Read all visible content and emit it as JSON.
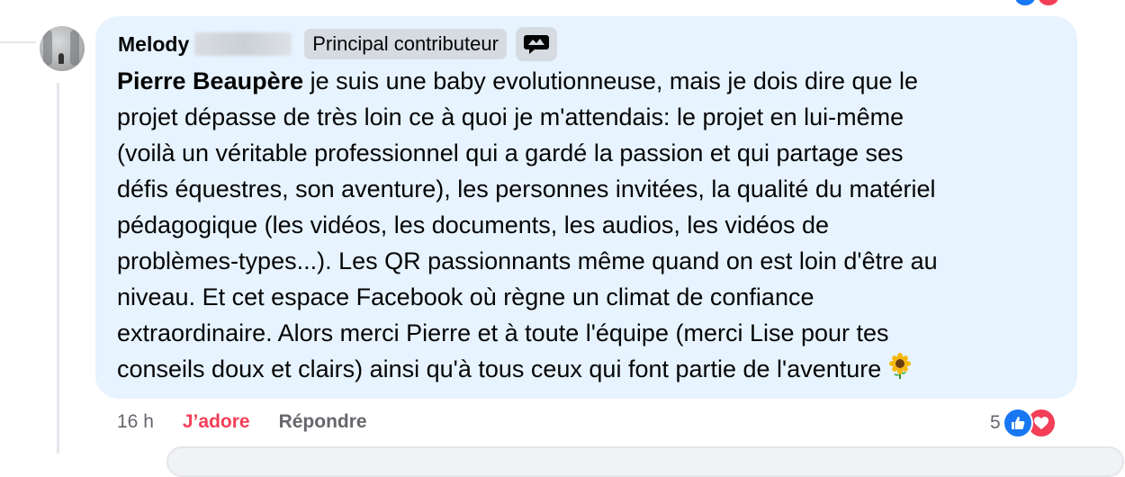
{
  "comment": {
    "author_name": "Melody",
    "author_badge": "Principal contributeur",
    "mention": "Pierre Beaupère",
    "body_lines": [
      " je suis une baby evolutionneuse, mais je dois dire que le",
      "projet dépasse de très loin ce à quoi je m'attendais: le projet en lui-même",
      "(voilà un véritable professionnel qui a gardé la passion et qui partage ses",
      "défis équestres, son aventure), les personnes invitées, la qualité du matériel",
      "pédagogique (les vidéos, les documents, les audios, les vidéos de",
      "problèmes-types...). Les QR passionnants même quand on est loin d'être au",
      "niveau. Et cet espace Facebook où règne un climat de confiance",
      "extraordinaire. Alors merci Pierre et à toute l'équipe (merci Lise pour tes",
      "conseils doux et clairs) ainsi qu'à tous ceux qui font partie de l'aventure"
    ],
    "emoji_icon": "sunflower-icon",
    "time": "16 h",
    "love_label": "J’adore",
    "reply_label": "Répondre",
    "reaction_count": "5",
    "reaction_icons": [
      "like-icon",
      "heart-icon"
    ]
  },
  "colors": {
    "bubble_bg": "#e7f3ff",
    "love_color": "#f33e58",
    "like_color": "#1877f2",
    "secondary_text": "#65676b"
  }
}
